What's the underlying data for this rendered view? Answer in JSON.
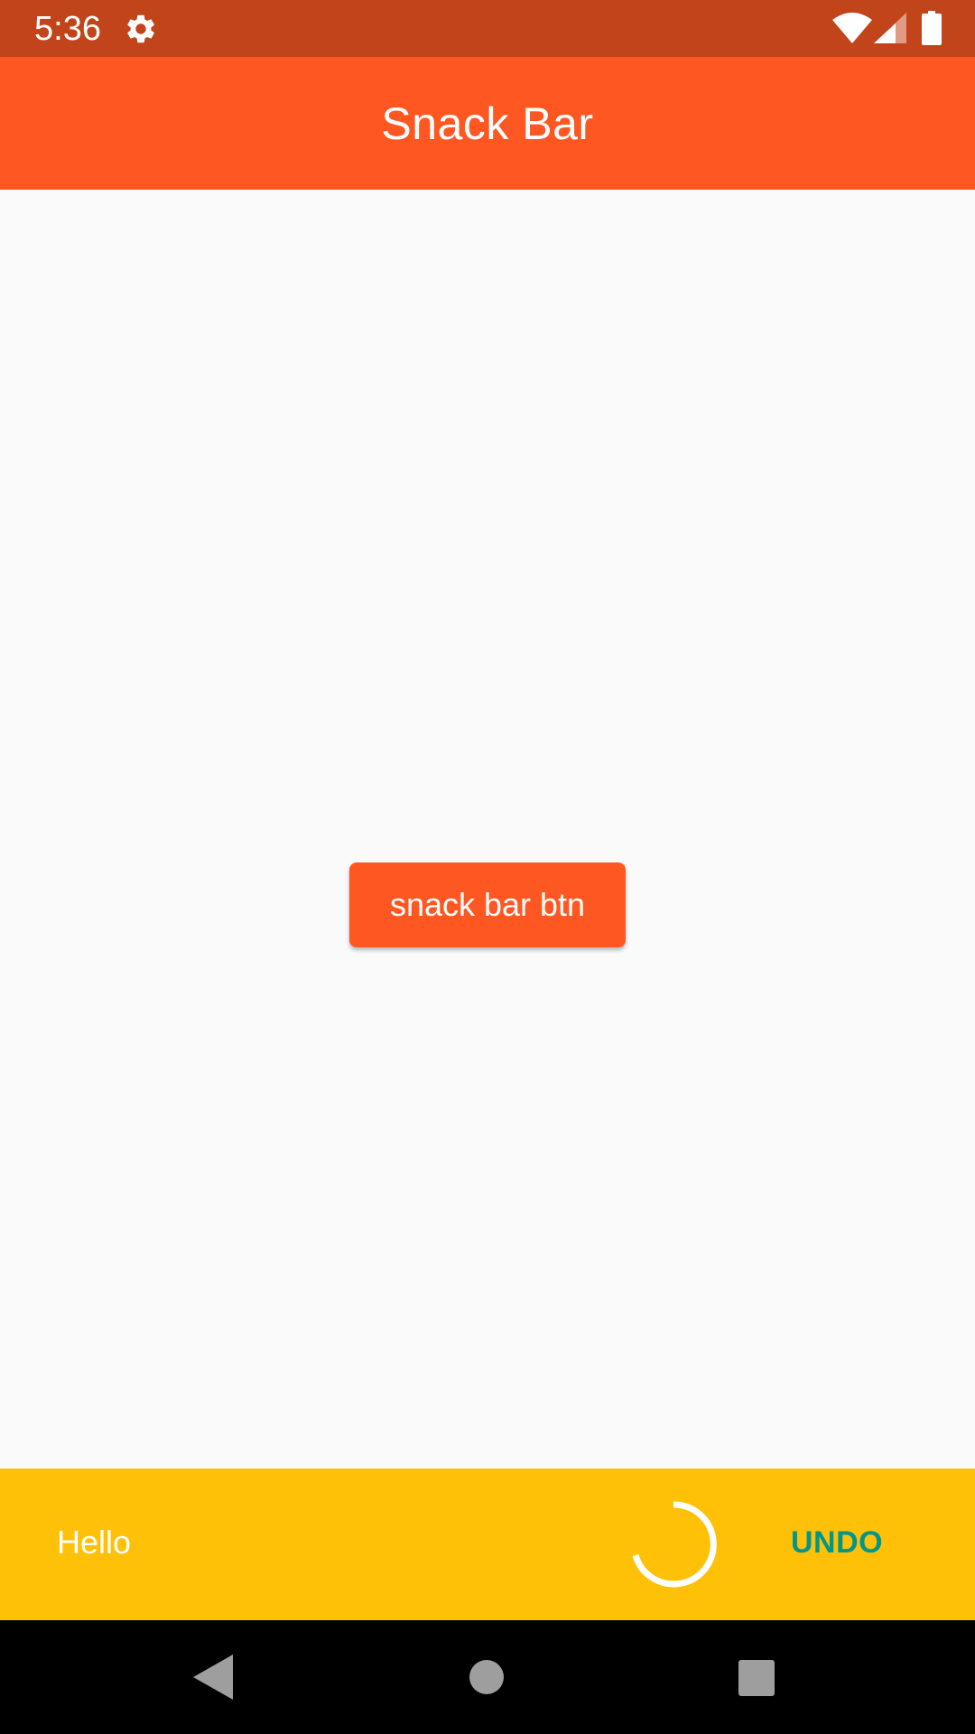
{
  "status_bar": {
    "time": "5:36",
    "background": "#c1441b",
    "icons": [
      "gear-icon",
      "wifi-icon",
      "signal-icon",
      "battery-icon"
    ]
  },
  "app_bar": {
    "title": "Snack Bar",
    "background": "#ff5722"
  },
  "main": {
    "button_label": "snack bar btn",
    "button_color": "#ff5722",
    "background": "#fafafa"
  },
  "snackbar": {
    "message": "Hello",
    "action_label": "UNDO",
    "background": "#ffc107",
    "action_color": "#00968a",
    "spinner_icon": "loading-spinner-icon"
  },
  "nav_bar": {
    "icons": [
      "back-icon",
      "home-icon",
      "recents-icon"
    ]
  }
}
